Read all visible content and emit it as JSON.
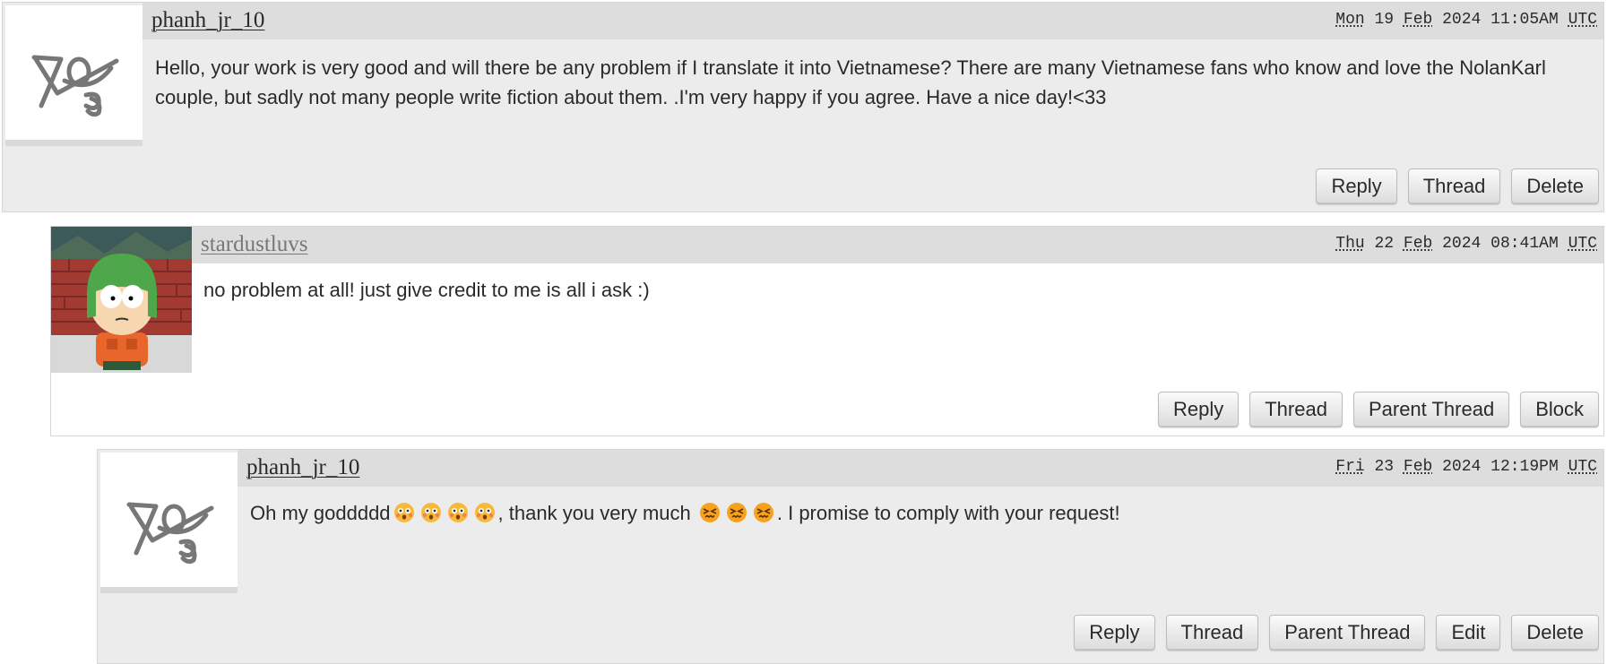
{
  "comments": [
    {
      "author": "phanh_jr_10",
      "date": {
        "day_abbr": "Mon",
        "day": "19",
        "month_abbr": "Feb",
        "year": "2024",
        "time": "11:05AM",
        "tz": "UTC"
      },
      "text": "Hello, your work is very good and will there be any problem if I translate it into Vietnamese? There are many Vietnamese fans who know and love the NolanKarl couple, but sadly not many people write fiction about them. .I'm very happy if you agree. Have a nice day!<33",
      "avatar": "default-ao3-logo-icon",
      "actions": [
        "Reply",
        "Thread",
        "Delete"
      ]
    },
    {
      "author": "stardustluvs",
      "date": {
        "day_abbr": "Thu",
        "day": "22",
        "month_abbr": "Feb",
        "year": "2024",
        "time": "08:41AM",
        "tz": "UTC"
      },
      "text": "no problem at all! just give credit to me is all i ask :)",
      "avatar": "kyle-south-park-avatar",
      "actions": [
        "Reply",
        "Thread",
        "Parent Thread",
        "Block"
      ]
    },
    {
      "author": "phanh_jr_10",
      "date": {
        "day_abbr": "Fri",
        "day": "23",
        "month_abbr": "Feb",
        "year": "2024",
        "time": "12:19PM",
        "tz": "UTC"
      },
      "text_parts": {
        "before_emoji": "Oh my goddddd",
        "middle": ", thank you very much ",
        "after": ". I promise to comply with your request!"
      },
      "emoji": {
        "shocked": "flushed-face-emoji",
        "confounded": "confounded-face-emoji"
      },
      "avatar": "default-ao3-logo-icon",
      "actions": [
        "Reply",
        "Thread",
        "Parent Thread",
        "Edit",
        "Delete"
      ]
    }
  ],
  "colors": {
    "gray_bg": "#ececec",
    "header_bg": "#dddddd",
    "text": "#2a2a2a",
    "muted_link": "#777777"
  }
}
